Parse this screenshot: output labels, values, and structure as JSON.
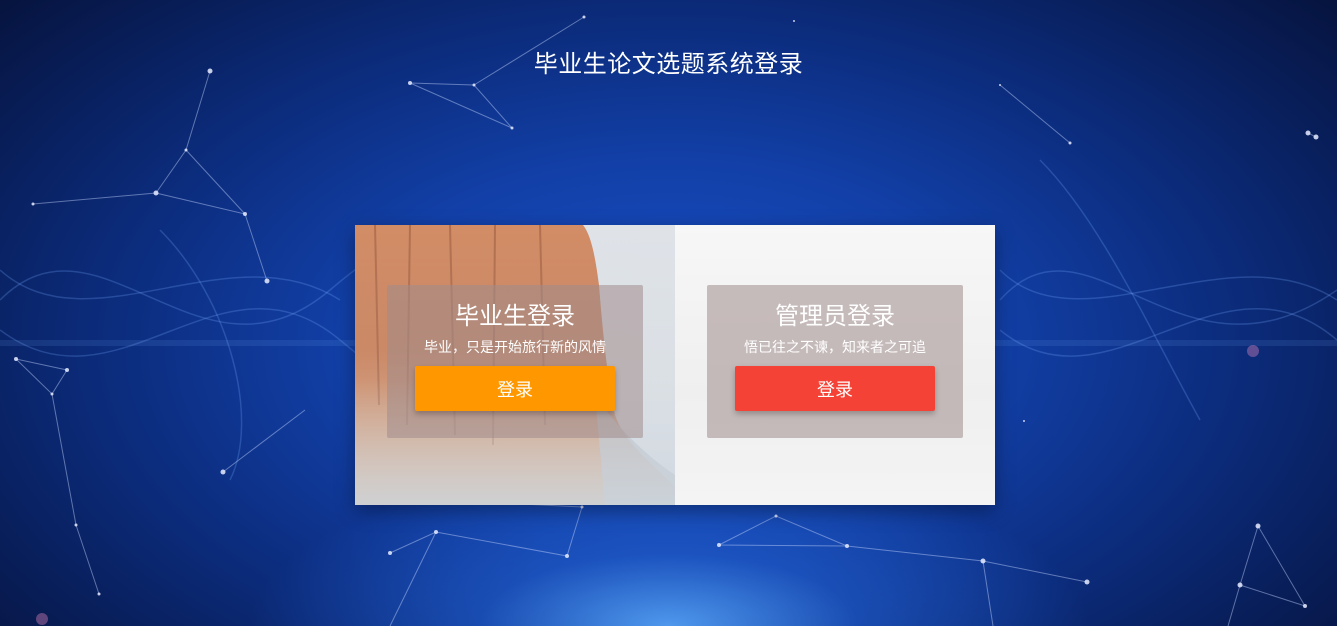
{
  "page": {
    "title": "毕业生论文选题系统登录"
  },
  "graduate_card": {
    "title": "毕业生登录",
    "subtitle": "毕业，只是开始旅行新的风情",
    "button_label": "登录",
    "button_color": "#ff9800"
  },
  "admin_card": {
    "title": "管理员登录",
    "subtitle": "悟已往之不谏，知来者之可追",
    "button_label": "登录",
    "button_color": "#f44336"
  }
}
